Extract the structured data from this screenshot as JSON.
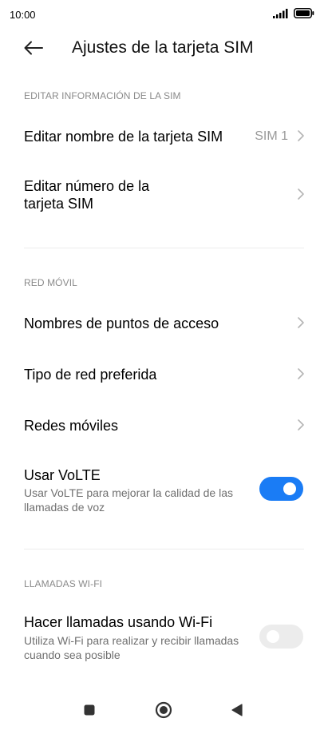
{
  "status_bar": {
    "time": "10:00"
  },
  "header": {
    "title": "Ajustes de la tarjeta SIM"
  },
  "sections": {
    "edit_sim": "EDITAR INFORMACIÓN DE LA SIM",
    "mobile_network": "RED MÓVIL",
    "wifi_calls": "LLAMADAS WI-FI"
  },
  "rows": {
    "edit_name": {
      "title": "Editar nombre de la tarjeta SIM",
      "value": "SIM 1"
    },
    "edit_number": {
      "title_line1": "Editar número de la",
      "title_line2": "tarjeta SIM"
    },
    "apn": {
      "title": "Nombres de puntos de acceso"
    },
    "network_type": {
      "title": "Tipo de red preferida"
    },
    "mobile_networks": {
      "title": "Redes móviles"
    },
    "volte": {
      "title": "Usar VoLTE",
      "sub_line1": "Usar VoLTE para mejorar la calidad de las",
      "sub_line2": "llamadas de voz",
      "enabled": true
    },
    "wifi_calling": {
      "title": "Hacer llamadas usando Wi-Fi",
      "sub_line1": "Utiliza Wi-Fi para realizar y recibir llamadas",
      "sub_line2": "cuando sea posible",
      "enabled": false
    }
  },
  "colors": {
    "accent": "#1a7cf5",
    "toggle_off": "#ececec",
    "section_text": "#8a8a8a"
  }
}
